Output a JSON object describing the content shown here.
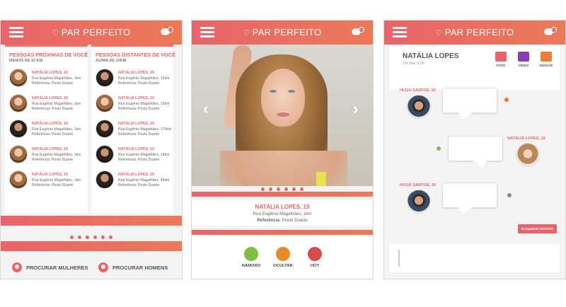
{
  "brand": {
    "name": "PAR PERFEITO",
    "badge_count": "12"
  },
  "colors": {
    "accent": "#e8646a",
    "accent2": "#eb7a57",
    "green": "#7fbf3f",
    "orange": "#e88a2a",
    "red": "#d84b4b"
  },
  "screen1": {
    "near": {
      "title": "PESSOAS PRÓXIMAS DE VOCÊ",
      "subtitle": "MENOS DE 10 KM",
      "people": [
        {
          "name": "NATÁLIA LOPES, 19",
          "addr": "Rua Eugênio Magalhães, 1km",
          "ref": "Referência: Posto Duarte"
        },
        {
          "name": "NATÁLIA LOPES, 19",
          "addr": "Rua Eugênio Magalhães, 1km",
          "ref": "Referência: Posto Duarte"
        },
        {
          "name": "NATÁLIA LOPES, 19",
          "addr": "Rua Eugênio Magalhães, 1km",
          "ref": "Referência: Posto Duarte"
        },
        {
          "name": "NATÁLIA LOPES, 19",
          "addr": "Rua Eugênio Magalhães, 1km",
          "ref": "Referência: Posto Duarte"
        },
        {
          "name": "NATÁLIA LOPES, 19",
          "addr": "Rua Eugênio Magalhães, 1km",
          "ref": "Referência: Posto Duarte"
        }
      ]
    },
    "far": {
      "title": "PESSOAS DISTANTES DE VOCÊ",
      "subtitle": "ACIMA DE 10KM",
      "people": [
        {
          "name": "NATÁLIA LOPES, 19",
          "addr": "Rua Eugênio Magalhães, 12km",
          "ref": "Referência: Posto Duarte"
        },
        {
          "name": "NATÁLIA LOPES, 19",
          "addr": "Rua Eugênio Magalhães, 15km",
          "ref": "Referência: Posto Duarte"
        },
        {
          "name": "NATÁLIA LOPES, 19",
          "addr": "Rua Eugênio Magalhães, 170km",
          "ref": "Referência: Posto Duarte"
        },
        {
          "name": "NATÁLIA LOPES, 19",
          "addr": "Rua Eugênio Magalhães, 19km",
          "ref": "Referência: Posto Duarte"
        },
        {
          "name": "NATÁLIA LOPES, 19",
          "addr": "Rua Eugênio Magalhães, 45km",
          "ref": "Referência: Posto Duarte"
        }
      ]
    },
    "search_women": "PROCURAR MULHERES",
    "search_men": "PROCURAR HOMENS"
  },
  "screen2": {
    "name": "NATÁLIA LOPES, 19",
    "addr": "Rua Eugênio Magalhães, 1km",
    "ref_label": "Referência:",
    "ref_value": "Posto Duarte",
    "actions": {
      "date": "NAMORO",
      "hide": "OCULTAR",
      "hot": "HOT"
    }
  },
  "screen3": {
    "contact_name": "NATÁLIA LOPES",
    "status": "On line à 2h",
    "buttons": {
      "photo": "FOTO",
      "video": "VÍDEO",
      "send": "ENVIAR"
    },
    "messages": [
      {
        "sender": "HUGO SANTOS, 30"
      },
      {
        "sender": "NATÁLIA LOPES, 19"
      },
      {
        "sender": "HUGO SANTOS, 30"
      }
    ],
    "block_label": "BLOQUEAR CONTATO"
  }
}
